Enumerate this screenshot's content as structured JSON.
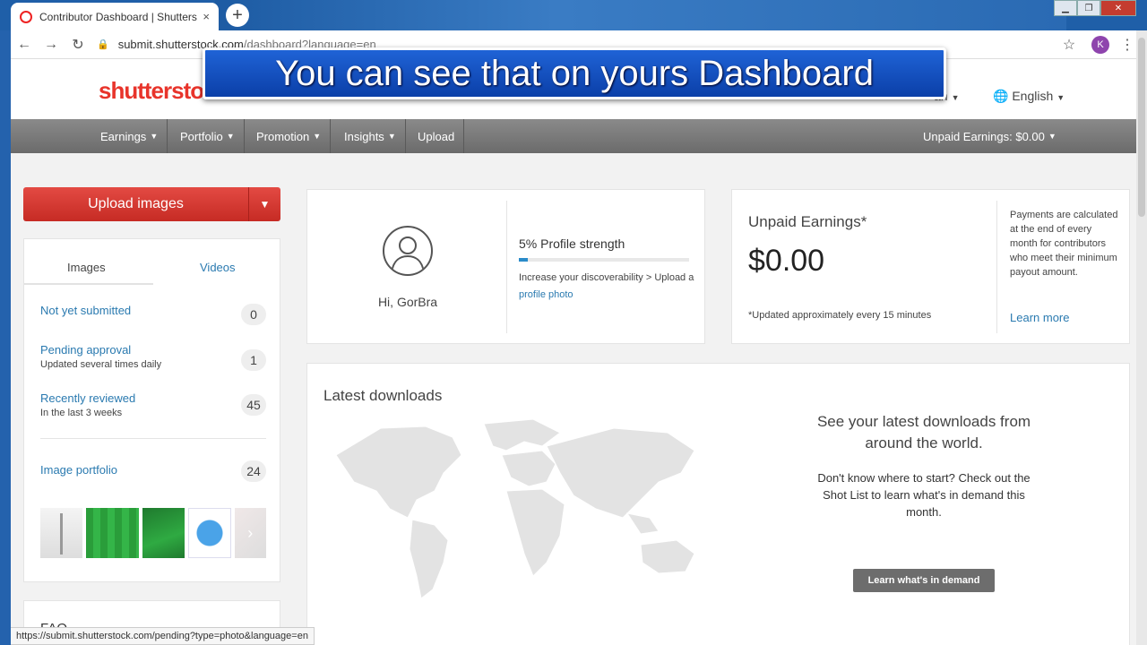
{
  "browser": {
    "tab_title": "Contributor Dashboard | Shutterstock",
    "tab_close": "×",
    "new_tab": "+",
    "url_host": "submit.shutterstock.com",
    "url_path": "/dashboard?language=en",
    "profile_initial": "K",
    "status_url": "https://submit.shutterstock.com/pending?type=photo&language=en"
  },
  "header": {
    "logo": "shutterstock",
    "user_menu": "an",
    "language": "English"
  },
  "overlay": {
    "caption": "You can see that on yours Dashboard"
  },
  "nav": {
    "items": [
      "Earnings",
      "Portfolio",
      "Promotion",
      "Insights",
      "Upload"
    ],
    "unpaid": "Unpaid Earnings: $0.00"
  },
  "sidebar": {
    "upload_label": "Upload images",
    "tabs": [
      "Images",
      "Videos"
    ],
    "stats": [
      {
        "label": "Not yet submitted",
        "sub": "",
        "count": "0"
      },
      {
        "label": "Pending approval",
        "sub": "Updated several times daily",
        "count": "1"
      },
      {
        "label": "Recently reviewed",
        "sub": "In the last 3 weeks",
        "count": "45"
      },
      {
        "label": "Image portfolio",
        "sub": "",
        "count": "24"
      }
    ],
    "faq": "FAQ"
  },
  "profile": {
    "greeting": "Hi, GorBra",
    "strength_title": "5% Profile strength",
    "strength_percent": 5,
    "tip_text": "Increase your discoverability > Upload a ",
    "tip_link": "profile photo"
  },
  "earnings": {
    "title": "Unpaid Earnings*",
    "value": "$0.00",
    "note": "*Updated approximately every 15 minutes",
    "side_text": "Payments are calculated at the end of every month for contributors who meet their minimum payout amount.",
    "link": "Learn more"
  },
  "downloads": {
    "title": "Latest downloads",
    "headline": "See your latest downloads from around the world.",
    "body": "Don't know where to start? Check out the Shot List to learn what's in demand this month.",
    "button": "Learn what's in demand"
  },
  "colors": {
    "brand_red": "#e8342b",
    "link_blue": "#2a7ab0",
    "nav_gray": "#7a7a7a"
  }
}
